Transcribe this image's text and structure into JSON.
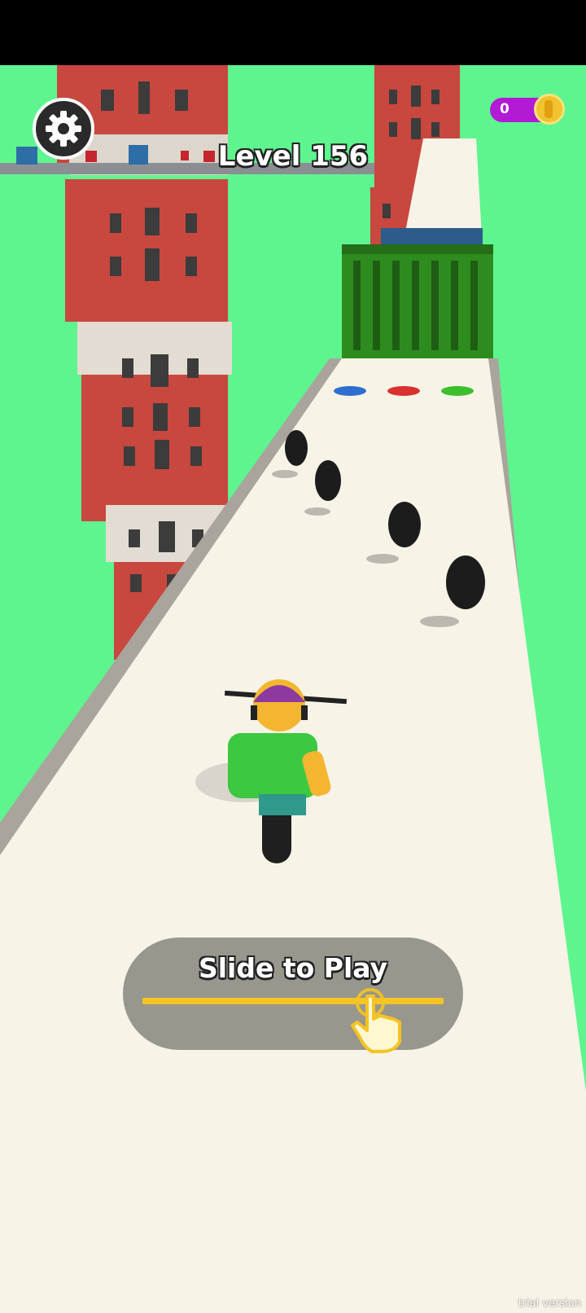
{
  "hud": {
    "level_label": "Level 156",
    "coins": "0"
  },
  "prompt": {
    "slide_label": "Slide to Play"
  },
  "watermark": "trial version",
  "icons": {
    "settings": "gear-icon",
    "coin": "coin-icon",
    "hand": "tap-hand-icon"
  },
  "colors": {
    "sky": "#5ef58f",
    "coin_pill": "#b21ad6",
    "slider": "#f3c423",
    "track": "#f7f3e6"
  }
}
